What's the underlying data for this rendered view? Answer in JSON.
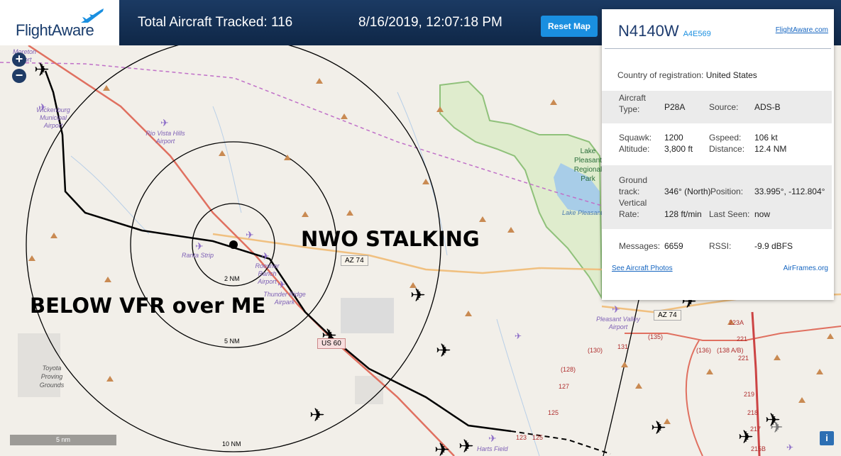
{
  "header": {
    "logo_text": "FlightAware",
    "total_tracked": "Total Aircraft Tracked: 116",
    "datetime": "8/16/2019, 12:07:18 PM",
    "reset_label": "Reset Map"
  },
  "overlay": {
    "stalking": "NWO STALKING",
    "below": "BELOW VFR over ME"
  },
  "map": {
    "zoom_in": "+",
    "zoom_out": "−",
    "scale": "5 nm",
    "info": "i",
    "rings": {
      "r2": "2 NM",
      "r5": "5 NM",
      "r10": "10 NM"
    },
    "places": {
      "moreton": "Moreton Airport",
      "wickenburg": "Wickenburg Municipal Airport",
      "riovista": "Rio Vista Hills Airport",
      "ranta": "Ranta Strip",
      "roesner": "Roesner Ranch Airport",
      "thunder": "Thunder Ridge Airpark",
      "toyota": "Toyota Proving Grounds",
      "lakeplea": "Lake Pleasant Regional Park",
      "lakepleasant": "Lake Pleasant",
      "pleasantvalley": "Pleasant Valley Airport",
      "harts": "Harts Field"
    },
    "roads": {
      "az74a": "AZ 74",
      "az74b": "AZ 74",
      "us60": "US 60",
      "r130": "(130)",
      "r131": "131",
      "r135": "(135)",
      "r136": "(136)",
      "r138": "(138 A/B)",
      "r128": "(128)",
      "r127": "127",
      "r125": "125",
      "r125b": "125",
      "r123": "123",
      "r223": "223A",
      "r221": "221",
      "r221b": "221",
      "r219": "219",
      "r218": "218",
      "r217": "217",
      "r215": "215B"
    }
  },
  "panel": {
    "registration": "N4140W",
    "hex": "A4E569",
    "link": "FlightAware.com",
    "country_label": "Country of registration:",
    "country_value": "United States",
    "aircraft_type_label": "Aircraft Type:",
    "aircraft_type_value": "P28A",
    "source_label": "Source:",
    "source_value": "ADS-B",
    "squawk_label": "Squawk:",
    "squawk_value": "1200",
    "gspeed_label": "Gspeed:",
    "gspeed_value": "106 kt",
    "altitude_label": "Altitude:",
    "altitude_value": "3,800 ft",
    "distance_label": "Distance:",
    "distance_value": "12.4 NM",
    "ground_track_label": "Ground track:",
    "ground_track_value": "346° (North)",
    "position_label": "Position:",
    "position_value": "33.995°, -112.804°",
    "vertical_rate_label": "Vertical Rate:",
    "vertical_rate_value": "128 ft/min",
    "last_seen_label": "Last Seen:",
    "last_seen_value": "now",
    "messages_label": "Messages:",
    "messages_value": "6659",
    "rssi_label": "RSSI:",
    "rssi_value": "-9.9 dBFS",
    "photos_link": "See Aircraft Photos",
    "airframes_link": "AirFrames.org"
  },
  "colors": {
    "header_bg": "#12305a",
    "accent": "#1a8fe0",
    "map_bg": "#f2efe9",
    "highway": "#f0a050",
    "road_red": "#e07060",
    "park": "#8fc17a",
    "lake": "#a8cde8"
  }
}
